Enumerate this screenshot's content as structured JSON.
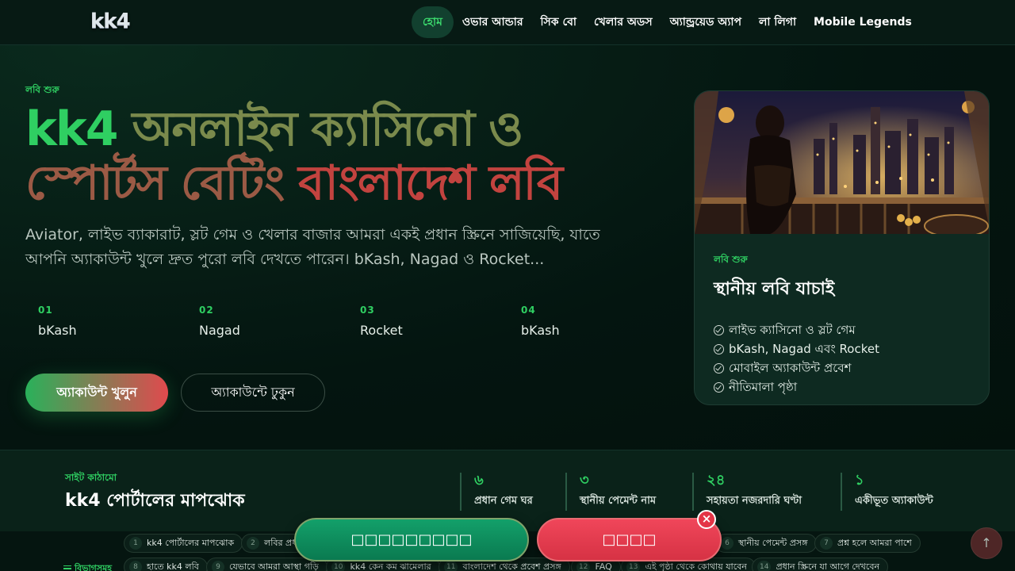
{
  "header": {
    "logo": "kk4",
    "nav": [
      "হোম",
      "ওভার আন্ডার",
      "সিক বো",
      "খেলার অডস",
      "অ্যান্ড্রয়েড অ্যাপ",
      "লা লিগা",
      "Mobile Legends"
    ]
  },
  "hero": {
    "eyebrow": "লবি শুরু",
    "title_part1": "kk4 ",
    "title_part2": "অনলাইন ক্যাসিনো ও",
    "title_part3": "স্পোর্টস বেটিং ",
    "title_part4": "বাংলাদেশ লবি",
    "description": "Aviator, লাইভ ব্যাকারাট, স্লট গেম ও খেলার বাজার আমরা একই প্রধান স্ক্রিনে সাজিয়েছি, যাতে আপনি অ্যাকাউন্ট খুলে দ্রুত পুরো লবি দেখতে পারেন। bKash, Nagad ও Rocket...",
    "stats": [
      {
        "num": "01",
        "label": "bKash"
      },
      {
        "num": "02",
        "label": "Nagad"
      },
      {
        "num": "03",
        "label": "Rocket"
      },
      {
        "num": "04",
        "label": "bKash"
      }
    ],
    "primary_button": "অ্যাকাউন্ট খুলুন",
    "secondary_button": "অ্যাকাউন্টে ঢুকুন"
  },
  "card": {
    "eyebrow": "লবি শুরু",
    "title": "স্থানীয় লবি যাচাই",
    "items": [
      "লাইভ ক্যাসিনো ও স্লট গেম",
      "bKash, Nagad এবং Rocket",
      "মোবাইল অ্যাকাউন্ট প্রবেশ",
      "নীতিমালা পৃষ্ঠা"
    ]
  },
  "structure": {
    "eyebrow": "সাইট কাঠামো",
    "title": "kk4 পোর্টালের মাপঝোক",
    "metrics": [
      {
        "num": "৬",
        "label": "প্রধান গেম ঘর"
      },
      {
        "num": "৩",
        "label": "স্থানীয় পেমেন্ট নাম"
      },
      {
        "num": "২৪",
        "label": "সহায়তা নজরদারি ঘণ্টা"
      },
      {
        "num": "১",
        "label": "একীভূত অ্যাকাউন্ট"
      }
    ]
  },
  "chips_row1": [
    {
      "num": "1",
      "label": "kk4 পোর্টালের মাপঝোক"
    },
    {
      "num": "2",
      "label": "লবির প্রধান"
    },
    {
      "num": "6",
      "label": "স্থানীয় পেমেন্ট প্রসঙ্গ"
    },
    {
      "num": "7",
      "label": "প্রশ্ন হলে আমরা পাশে"
    }
  ],
  "chips_row2": [
    {
      "num": "8",
      "label": "হাতে kk4 লবি"
    },
    {
      "num": "9",
      "label": "যেভাবে আমরা আস্থা গড়ি"
    },
    {
      "num": "10",
      "label": "kk4 কেন কম ঝামেলার"
    },
    {
      "num": "11",
      "label": "বাংলাদেশ থেকে প্রবেশ প্রসঙ্গ"
    },
    {
      "num": "12",
      "label": "FAQ"
    },
    {
      "num": "13",
      "label": "এই পৃষ্ঠা থেকে কোথায় যাবেন"
    },
    {
      "num": "14",
      "label": "প্রধান স্ক্রিনে যা আগে দেখবেন"
    }
  ],
  "section_label": "বিভাগসমূহ",
  "floating": {
    "green_label": "□□□□□□□□□",
    "red_label": "□□□□",
    "close": "×",
    "scroll_top": "↑"
  }
}
